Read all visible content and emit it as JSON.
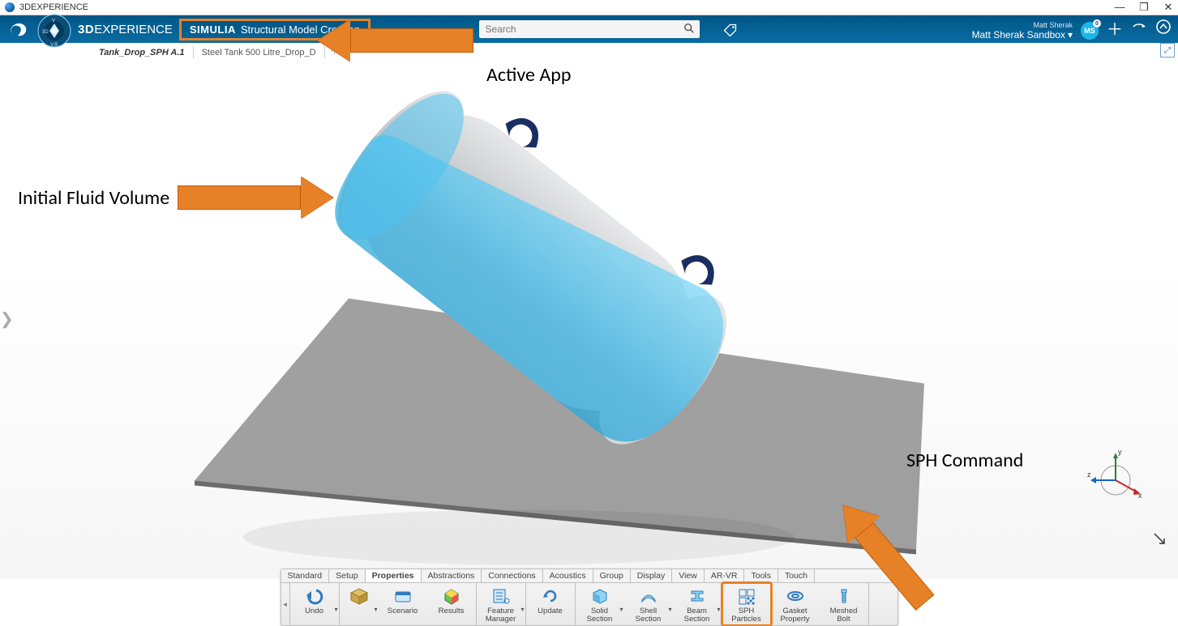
{
  "window": {
    "title": "3DEXPERIENCE"
  },
  "header": {
    "brand_bold": "3D",
    "brand_rest": "EXPERIENCE",
    "active_app_brand": "SIMULIA",
    "active_app_name": "Structural Model Creation",
    "search_placeholder": "Search",
    "user_small": "Matt Sherak",
    "sandbox_label": "Matt Sherak Sandbox",
    "avatar_initials": "MS",
    "avatar_badge": "0"
  },
  "doc_tabs": {
    "items": [
      {
        "label": "Tank_Drop_SPH A.1",
        "active": true
      },
      {
        "label": "Steel Tank 500 Litre_Drop_D",
        "active": false
      }
    ]
  },
  "annotations": {
    "active_app": "Active App",
    "fluid": "Initial Fluid Volume",
    "sph": "SPH Command"
  },
  "triad": {
    "x": "x",
    "y": "y",
    "z": "z"
  },
  "actionbar": {
    "tabs": [
      "Standard",
      "Setup",
      "Properties",
      "Abstractions",
      "Connections",
      "Acoustics",
      "Group",
      "Display",
      "View",
      "AR-VR",
      "Tools",
      "Touch"
    ],
    "active_tab": "Properties",
    "buttons": {
      "undo": "Undo",
      "scenario": "Scenario",
      "results": "Results",
      "feature_manager": "Feature\nManager",
      "update": "Update",
      "solid_section": "Solid\nSection",
      "shell_section": "Shell\nSection",
      "beam_section": "Beam\nSection",
      "sph_particles": "SPH\nParticles",
      "gasket_property": "Gasket\nProperty",
      "meshed_bolt": "Meshed\nBolt"
    }
  },
  "colors": {
    "orange": "#e78128",
    "header_blue": "#005686",
    "fluid_blue": "#4ec3f0",
    "tank_gray": "#c9ccce",
    "floor_gray": "#8f8f8f",
    "bracket_navy": "#1b2e63"
  }
}
